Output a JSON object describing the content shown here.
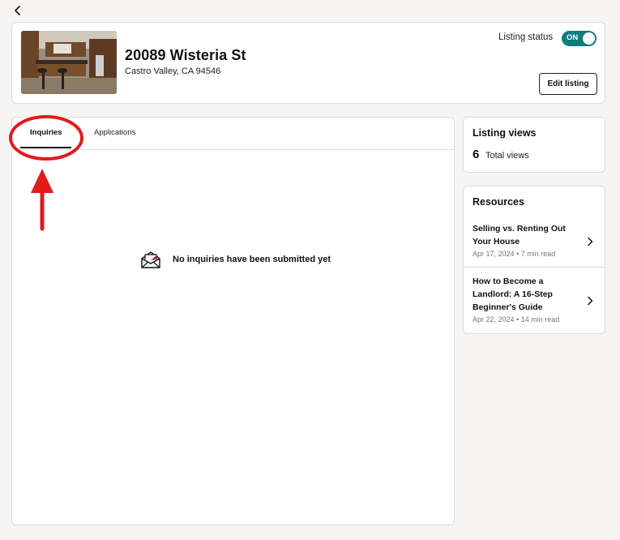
{
  "listing": {
    "address": "20089 Wisteria St",
    "city_line": "Castro Valley, CA 94546",
    "status_label": "Listing status",
    "status_toggle": "ON",
    "edit_button": "Edit listing"
  },
  "tabs": [
    {
      "label": "Inquiries",
      "active": true
    },
    {
      "label": "Applications",
      "active": false
    }
  ],
  "empty_state": {
    "icon": "envelope-icon",
    "message": "No inquiries have been submitted yet"
  },
  "listing_views": {
    "title": "Listing views",
    "count": "6",
    "label": "Total views"
  },
  "resources": {
    "title": "Resources",
    "items": [
      {
        "title": "Selling vs. Renting Out Your House",
        "meta": "Apr 17, 2024 • 7 min read"
      },
      {
        "title": "How to Become a Landlord: A 16-Step Beginner's Guide",
        "meta": "Apr 22, 2024 • 14 min read"
      }
    ]
  },
  "colors": {
    "accent": "#0f7c7c",
    "annotation": "#e31a1a",
    "background": "#f6f5f4"
  },
  "icons": [
    "back-chevron-icon",
    "envelope-icon",
    "chevron-right-icon"
  ]
}
